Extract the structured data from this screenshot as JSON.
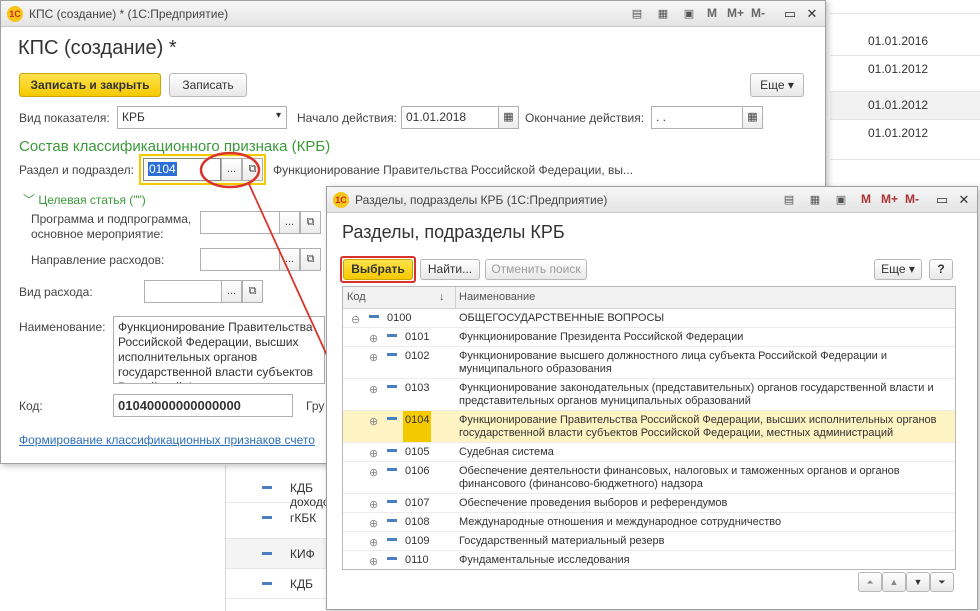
{
  "bg_dates": [
    "01.01.2016",
    "01.01.2012",
    "01.01.2012",
    "01.01.2012"
  ],
  "bg_items": [
    "КДБ доходов",
    "гКБК",
    "КИФ",
    "КДБ"
  ],
  "win1": {
    "title": "КПС (создание) * (1С:Предприятие)",
    "heading": "КПС (создание) *",
    "save_close": "Записать и закрыть",
    "save": "Записать",
    "more": "Еще",
    "indicator_label": "Вид показателя:",
    "indicator_value": "КРБ",
    "start_label": "Начало действия:",
    "start_value": "01.01.2018",
    "end_label": "Окончание действия:",
    "end_value": " .  .",
    "section_title": "Состав классификационного признака (КРБ)",
    "razdel_label": "Раздел и подраздел:",
    "razdel_code": "0104",
    "razdel_name": "Функционирование Правительства Российской Федерации, вы...",
    "target_title": "Целевая статья (\"\")",
    "program_label": "Программа и подпрограмма, основное мероприятие:",
    "direction_label": "Направление расходов:",
    "expense_label": "Вид расхода:",
    "name_label": "Наименование:",
    "name_value": "Функционирование Правительства Российской Федерации, высших исполнительных органов государственной власти субъектов Российской Федерации, м",
    "code_label": "Код:",
    "code_value": "01040000000000000",
    "group_label": "Гру",
    "link": "Формирование классификационных признаков счето"
  },
  "win2": {
    "title": "Разделы, подразделы КРБ  (1С:Предприятие)",
    "heading": "Разделы, подразделы КРБ",
    "select": "Выбрать",
    "find": "Найти...",
    "cancel_search": "Отменить поиск",
    "more": "Еще",
    "help": "?",
    "col_code": "Код",
    "col_name": "Наименование",
    "rows": [
      {
        "code": "0100",
        "name": "ОБЩЕГОСУДАРСТВЕННЫЕ ВОПРОСЫ"
      },
      {
        "code": "0101",
        "name": "Функционирование Президента Российской Федерации"
      },
      {
        "code": "0102",
        "name": "Функционирование высшего должностного лица субъекта Российской Федерации и муниципального образования"
      },
      {
        "code": "0103",
        "name": "Функционирование законодательных (представительных) органов государственной власти и представительных органов муниципальных образований"
      },
      {
        "code": "0104",
        "name": "Функционирование Правительства Российской Федерации, высших исполнительных органов государственной власти субъектов Российской Федерации, местных администраций"
      },
      {
        "code": "0105",
        "name": "Судебная система"
      },
      {
        "code": "0106",
        "name": "Обеспечение деятельности финансовых, налоговых и таможенных органов и органов финансового (финансово-бюджетного) надзора"
      },
      {
        "code": "0107",
        "name": "Обеспечение проведения выборов и референдумов"
      },
      {
        "code": "0108",
        "name": "Международные отношения и международное сотрудничество"
      },
      {
        "code": "0109",
        "name": "Государственный материальный резерв"
      },
      {
        "code": "0110",
        "name": "Фундаментальные исследования"
      }
    ]
  }
}
